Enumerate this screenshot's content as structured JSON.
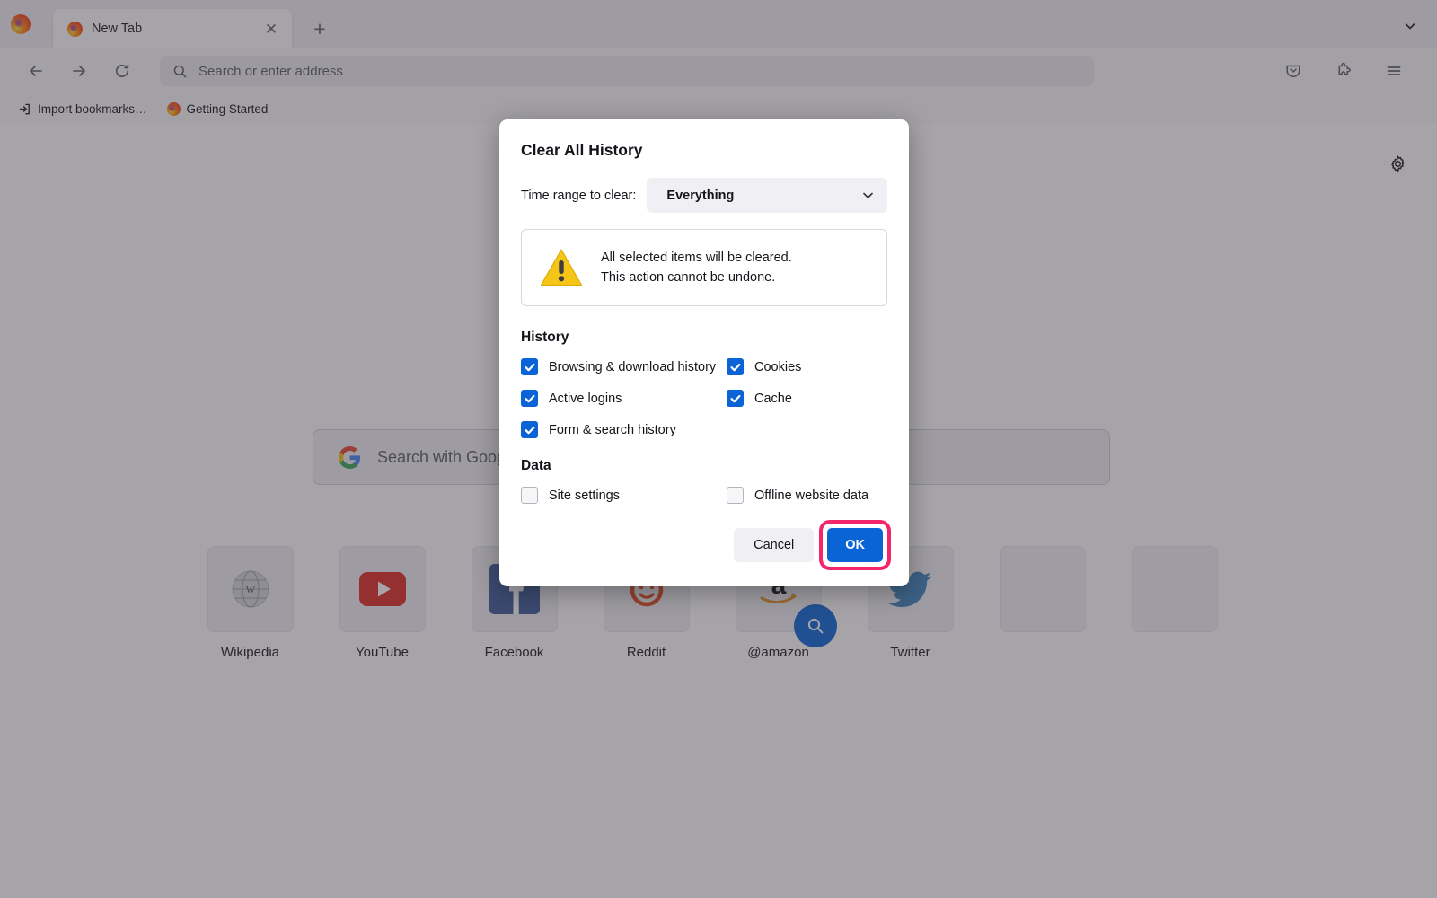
{
  "browser": {
    "tab": {
      "title": "New Tab",
      "close_icon": "close-icon",
      "favicon": "firefox-icon"
    },
    "new_tab_button": "+",
    "tab_list_icon": "chevron-down-icon",
    "nav": {
      "back_icon": "arrow-left-icon",
      "forward_icon": "arrow-right-icon",
      "reload_icon": "reload-icon",
      "search_icon": "search-icon",
      "address_placeholder": "Search or enter address",
      "pocket_icon": "pocket-save-icon",
      "extensions_icon": "puzzle-piece-icon",
      "menu_icon": "hamburger-menu-icon"
    },
    "bookmarks": [
      {
        "label": "Import bookmarks…",
        "icon": "import-icon"
      },
      {
        "label": "Getting Started",
        "icon": "firefox-icon"
      }
    ]
  },
  "newtab": {
    "settings_icon": "gear-icon",
    "search": {
      "engine_icon": "google-icon",
      "placeholder": "Search with Google"
    },
    "tiles": [
      {
        "label": "Wikipedia",
        "icon": "wikipedia-icon",
        "empty": false
      },
      {
        "label": "YouTube",
        "icon": "youtube-icon",
        "empty": false
      },
      {
        "label": "Facebook",
        "icon": "facebook-icon",
        "empty": false
      },
      {
        "label": "Reddit",
        "icon": "reddit-icon",
        "empty": false
      },
      {
        "label": "@amazon",
        "icon": "amazon-icon",
        "empty": false,
        "badge_icon": "search-badge-icon"
      },
      {
        "label": "Twitter",
        "icon": "twitter-icon",
        "empty": false
      },
      {
        "label": "",
        "icon": "",
        "empty": true
      },
      {
        "label": "",
        "icon": "",
        "empty": true
      }
    ]
  },
  "dialog": {
    "title": "Clear All History",
    "time_range_label": "Time range to clear:",
    "time_range_value": "Everything",
    "time_range_chevron": "chevron-down-icon",
    "warning": {
      "icon": "warning-triangle-icon",
      "line1": "All selected items will be cleared.",
      "line2": "This action cannot be undone."
    },
    "history_section": "History",
    "history_items": [
      {
        "label": "Browsing & download history",
        "checked": true
      },
      {
        "label": "Cookies",
        "checked": true
      },
      {
        "label": "Active logins",
        "checked": true
      },
      {
        "label": "Cache",
        "checked": true
      },
      {
        "label": "Form & search history",
        "checked": true
      },
      {
        "label": "",
        "checked": false,
        "blank": true
      }
    ],
    "data_section": "Data",
    "data_items": [
      {
        "label": "Site settings",
        "checked": false
      },
      {
        "label": "Offline website data",
        "checked": false
      }
    ],
    "cancel_label": "Cancel",
    "ok_label": "OK",
    "highlight_color": "#f5256b",
    "accent_color": "#0a64d6"
  }
}
